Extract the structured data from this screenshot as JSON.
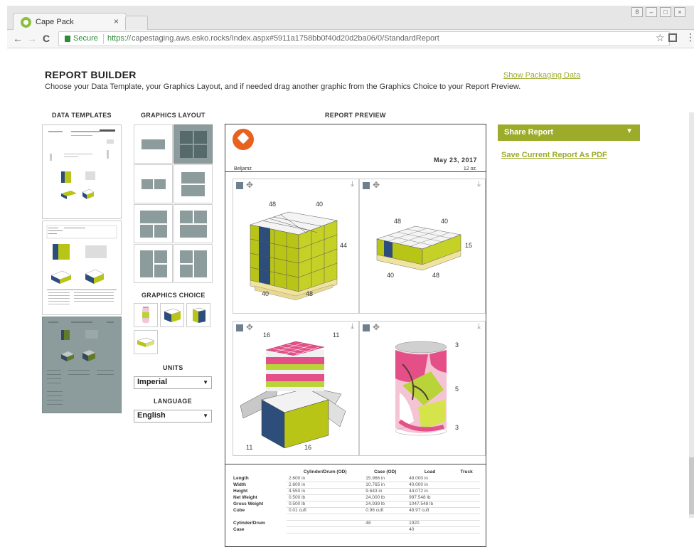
{
  "browser": {
    "tab_title": "Cape Pack",
    "tab_close": "×",
    "secure_label": "Secure",
    "url_scheme": "https://",
    "url_rest": "capestaging.aws.esko.rocks/Index.aspx#5911a1758bb0f40d20d2ba06/0/StandardReport",
    "back": "←",
    "forward": "→",
    "reload": "C",
    "star": "☆",
    "menu": "⋮"
  },
  "header": {
    "title": "REPORT BUILDER",
    "subtitle": "Choose your Data Template, your Graphics Layout, and if needed drag another graphic from the Graphics Choice to your Report Preview.",
    "show_packaging_link": "Show Packaging Data"
  },
  "columns": {
    "data_templates": "DATA TEMPLATES",
    "graphics_layout": "GRAPHICS LAYOUT",
    "report_preview": "REPORT PREVIEW",
    "graphics_choice": "GRAPHICS CHOICE",
    "units": "UNITS",
    "language": "LANGUAGE"
  },
  "units_value": "Imperial",
  "language_value": "English",
  "share": {
    "label": "Share Report",
    "arrow": "▼",
    "save_pdf": "Save Current Report As PDF"
  },
  "preview": {
    "date": "May 23, 2017",
    "name": "Beljamz",
    "size": "12 oz.",
    "panels": [
      {
        "dims": [
          "48",
          "40",
          "44",
          "40",
          "48"
        ]
      },
      {
        "dims": [
          "48",
          "40",
          "15",
          "40",
          "48"
        ]
      },
      {
        "dims": [
          "16",
          "11",
          "11",
          "16"
        ]
      },
      {
        "dims": [
          "3",
          "5",
          "3"
        ]
      }
    ],
    "table": {
      "headers": [
        "",
        "Cylinder/Drum (OD)",
        "Case (OD)",
        "Load",
        "Truck"
      ],
      "rows": [
        {
          "label": "Length",
          "values": [
            "2.600  in",
            "15.966  in",
            "48.000  in",
            ""
          ]
        },
        {
          "label": "Width",
          "values": [
            "2.600  in",
            "10.765  in",
            "40.000  in",
            ""
          ]
        },
        {
          "label": "Height",
          "values": [
            "4.550  in",
            "9.643  in",
            "44.072  in",
            ""
          ]
        },
        {
          "label": "Net Weight",
          "values": [
            "0.500  lb",
            "24.000  lb",
            "997.548  lb",
            ""
          ]
        },
        {
          "label": "Gross Weight",
          "values": [
            "0.500  lb",
            "24.939  lb",
            "1047.548  lb",
            ""
          ]
        },
        {
          "label": "Cube",
          "values": [
            "0.01  cuft",
            "0.96  cuft",
            "48.97  cuft",
            ""
          ]
        },
        {
          "label": "",
          "values": [
            "",
            "",
            "",
            ""
          ]
        },
        {
          "label": "Cylinder/Drum",
          "values": [
            "",
            "48",
            "1920",
            ""
          ]
        },
        {
          "label": "Case",
          "values": [
            "",
            "",
            "40",
            ""
          ]
        }
      ]
    }
  }
}
